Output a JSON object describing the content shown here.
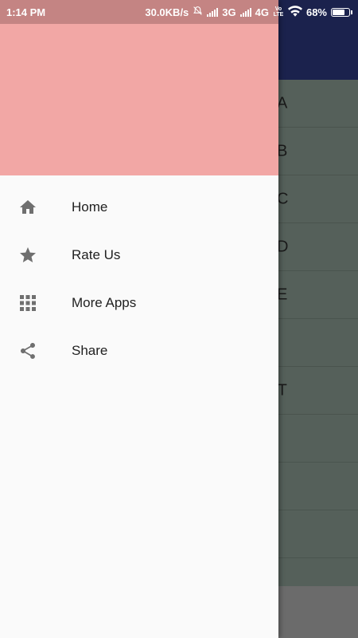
{
  "status_bar": {
    "time": "1:14 PM",
    "speed": "30.0KB/s",
    "network_3g": "3G",
    "network_4g": "4G",
    "volte": "Vo LTE",
    "battery": "68%",
    "battery_level": 0.68,
    "icons": [
      "alarm-off-icon",
      "signal-icon",
      "signal-icon",
      "volte-icon",
      "wifi-icon",
      "battery-icon"
    ]
  },
  "drawer": {
    "header_color": "#f2a7a5",
    "menu": [
      {
        "label": "Home",
        "icon": "home-icon"
      },
      {
        "label": "Rate Us",
        "icon": "star-icon"
      },
      {
        "label": "More Apps",
        "icon": "apps-grid-icon"
      },
      {
        "label": "Share",
        "icon": "share-icon"
      }
    ]
  },
  "background_list": {
    "rows": [
      "A",
      "B",
      "C",
      "D",
      "E",
      "",
      "EST",
      "",
      "",
      ""
    ]
  },
  "colors": {
    "toolbar": "#1b224d",
    "list_bg": "#55605a",
    "drawer_bg": "#fafafa",
    "icon": "#6f6f6f"
  }
}
